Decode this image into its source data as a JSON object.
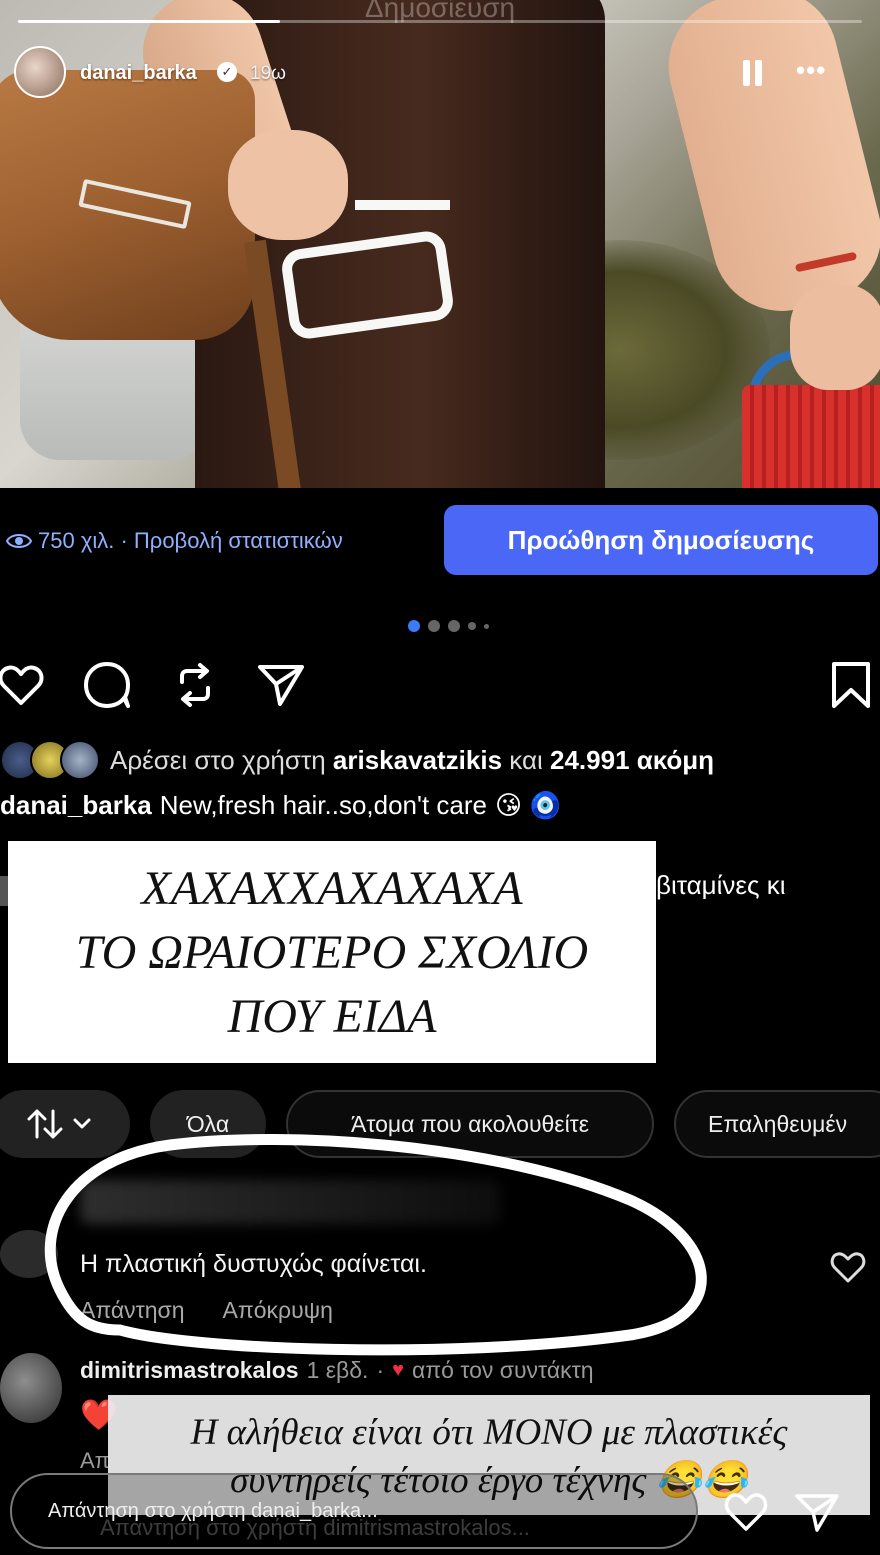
{
  "story": {
    "faded_title": "Δημοσίευση",
    "username": "danai_barka",
    "time": "19ω",
    "verified_mark": "✓",
    "more_label": "•••",
    "progress": 0.31
  },
  "post": {
    "views": "750 χιλ. · Προβολή στατιστικών",
    "promote_label": "Προώθηση δημοσίευσης",
    "likes_prefix": "Αρέσει στο χρήστη",
    "likes_user": "ariskavatzikis",
    "likes_mid": "και",
    "likes_count": "24.991 ακόμη",
    "caption_user": "danai_barka",
    "caption_text": "New,fresh hair..so,don't care",
    "caption_emojis": "😘 🧿",
    "behind_text": "βιταμίνες κι"
  },
  "overlay_card": {
    "line1": "ΧΑΧΑΧΧΑΧΑΧΑΧΑ",
    "line2": "ΤΟ ΩΡΑΙΟΤΕΡΟ ΣΧΟΛΙΟ",
    "line3": "ΠΟΥ ΕΙΔΑ"
  },
  "filters": {
    "all": "Όλα",
    "following": "Άτομα που ακολουθείτε",
    "verified": "Επαληθευμέν"
  },
  "comment1": {
    "text": "Η πλαστική δυστυχώς φαίνεται.",
    "reply": "Απάντηση",
    "hide": "Απόκρυψη"
  },
  "comment2": {
    "user": "dimitrismastrokalos",
    "time": "1 εβδ.",
    "sep": "·",
    "author_label": "από τον συντάκτη",
    "emoji": "❤️",
    "reply": "Απ"
  },
  "bottom_card": {
    "line1": "Η αλήθεια είναι ότι ΜΟΝΟ με πλαστικές",
    "line2": "συντηρείς τέτοιο έργο τέχνης 😂😂"
  },
  "reply_bar": {
    "placeholder": "Απάντηση στο χρήστη danai_barka...",
    "under_text": "Απάντηση στο χρήστη dimitrismastrokalos..."
  },
  "colors": {
    "accent": "#4a68f5",
    "stats": "#8fb0ff",
    "heart_red": "#ed3048"
  }
}
